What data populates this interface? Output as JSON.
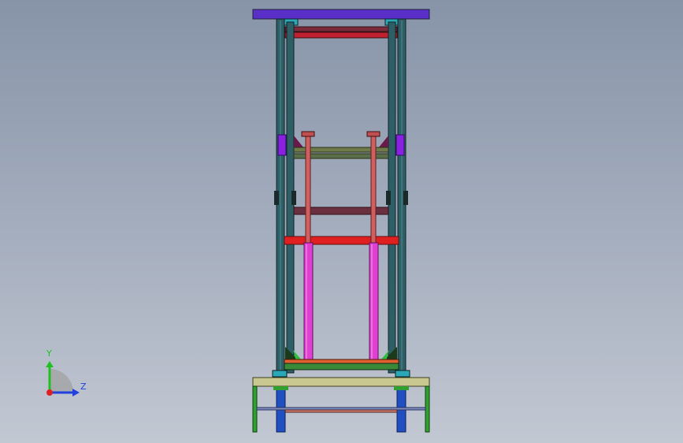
{
  "viewport": {
    "background_top": "#8794a8",
    "background_bottom": "#c2c8d2"
  },
  "triad": {
    "x_color": "#e02020",
    "y_color": "#20c020",
    "z_color": "#2040e0",
    "y_label": "Y",
    "z_label": "Z"
  },
  "colors": {
    "top_plate": "#5a2fc8",
    "column": "#2f5f66",
    "column_light": "#4f8a90",
    "beam_red": "#e02020",
    "beam_dark": "#7a2a3a",
    "beam_green": "#6e7a4a",
    "cylinder": "#e040d0",
    "rod": "#d06060",
    "bracket_purple": "#8a20e0",
    "table_top": "#c8c890",
    "leg_green": "#30a030",
    "leg_blue": "#2050c0",
    "base_orange": "#e06030",
    "clamp": "#2aa8b8"
  }
}
